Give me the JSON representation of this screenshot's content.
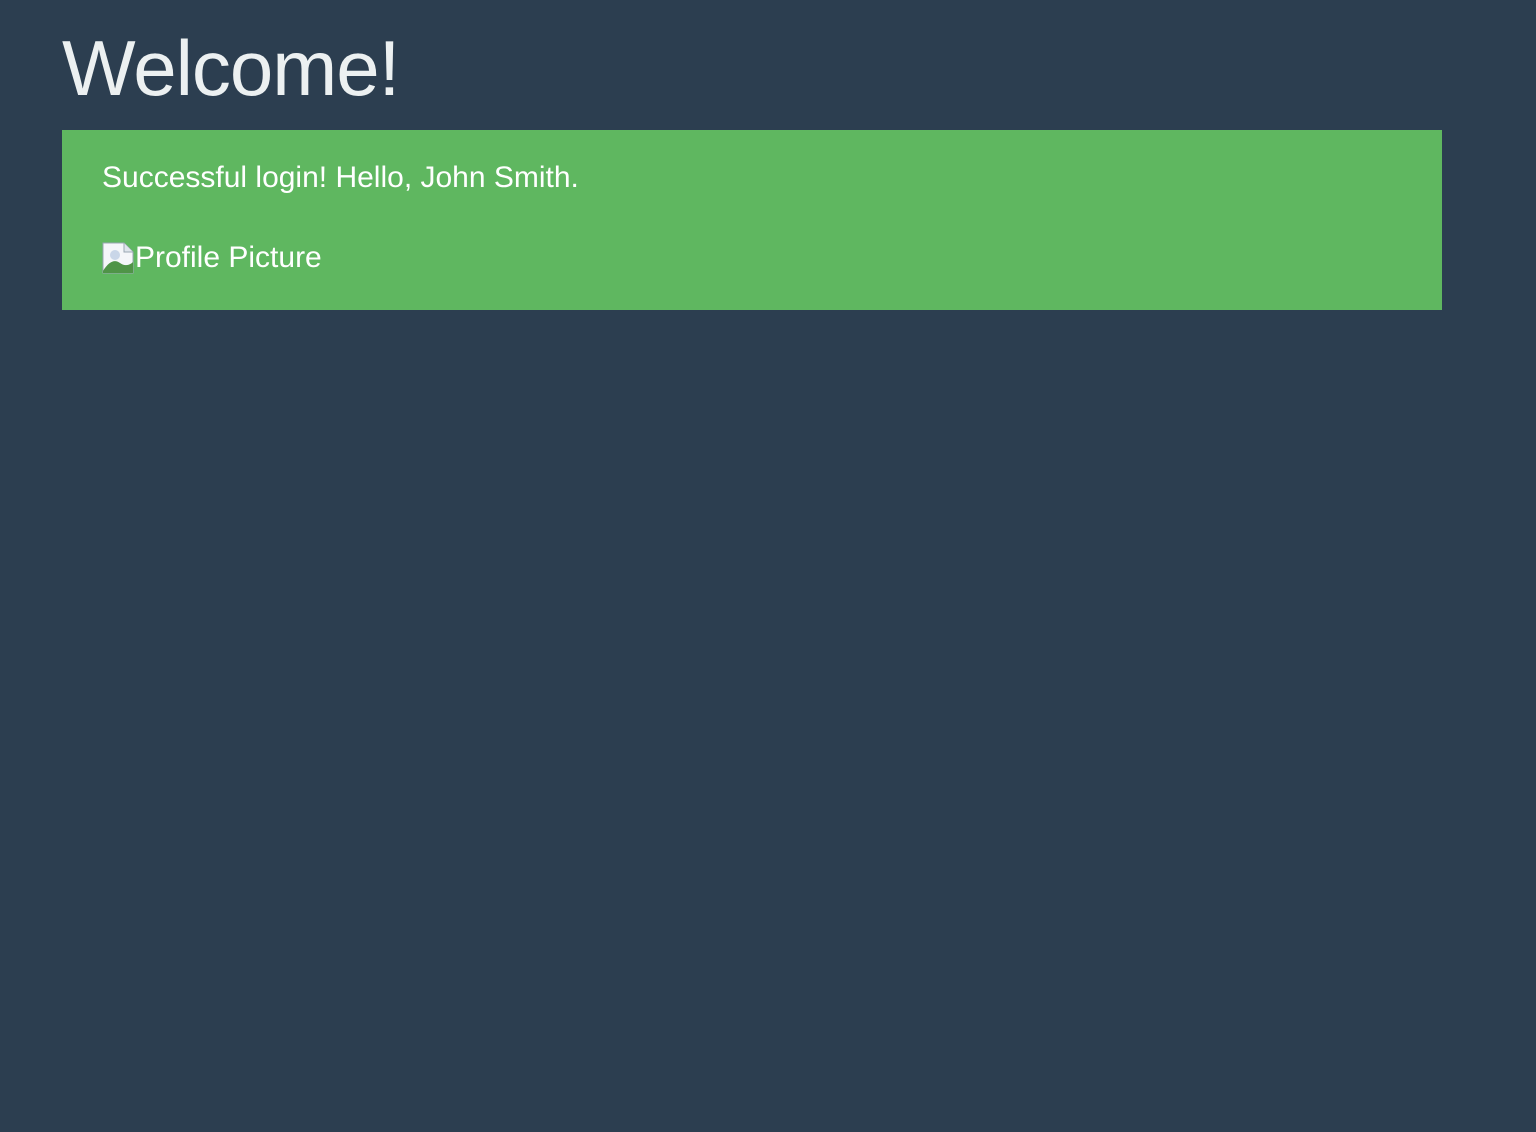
{
  "page": {
    "title": "Welcome!",
    "background_color": "#2c3e50"
  },
  "alert": {
    "message": "Successful login! Hello, John Smith.",
    "color": "#5fb760",
    "profile_picture": {
      "icon": "broken-image-icon",
      "alt_text": "Profile Picture"
    }
  }
}
